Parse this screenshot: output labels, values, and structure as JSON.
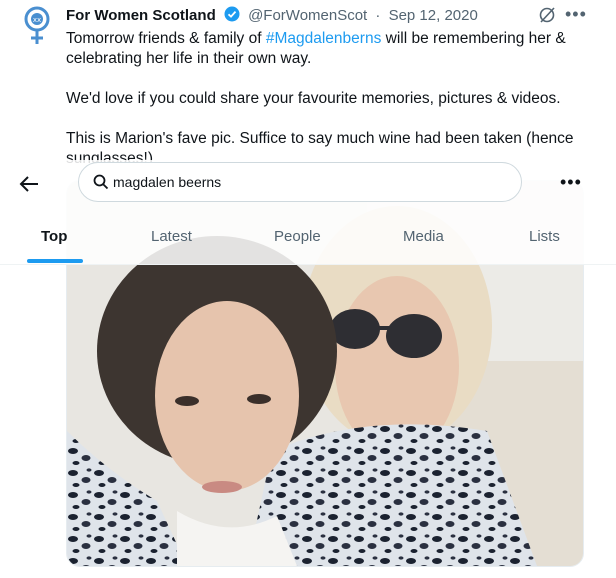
{
  "tweet": {
    "author": "For Women Scotland",
    "handle": "@ForWomenScot",
    "separator": "·",
    "date": "Sep 12, 2020",
    "line1_pre": "Tomorrow friends & family of ",
    "line1_hashtag": "#Magdalenberns",
    "line1_post": " will be remembering her &",
    "line2": "celebrating her life in their own way.",
    "para2": "We'd love if you could share your favourite memories, pictures & videos.",
    "para3": "This is Marion's fave pic. Suffice to say much wine had been taken (hence",
    "para3_cut": "sunglasses!)",
    "more_glyph": "•••"
  },
  "search": {
    "value": "magdalen beerns",
    "more_glyph": "•••"
  },
  "tabs": [
    "Top",
    "Latest",
    "People",
    "Media",
    "Lists"
  ],
  "colors": {
    "accent": "#1d9bf0",
    "text": "#0f1419",
    "muted": "#536471"
  }
}
